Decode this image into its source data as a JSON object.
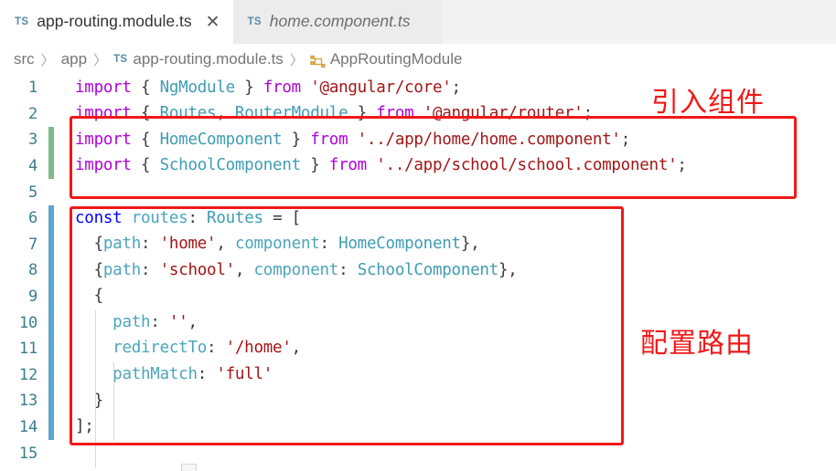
{
  "window": {
    "app": "Visual Studio Code",
    "theme": "light"
  },
  "tabs": [
    {
      "icon": "ts-file-icon",
      "label": "app-routing.module.ts",
      "active": true,
      "preview": false,
      "close_glyph": "✕"
    },
    {
      "icon": "ts-file-icon",
      "label": "home.component.ts",
      "active": false,
      "preview": true
    }
  ],
  "breadcrumb": {
    "separator": "〉",
    "items": [
      {
        "label": "src",
        "icon": null
      },
      {
        "label": "app",
        "icon": null
      },
      {
        "label": "app-routing.module.ts",
        "icon": "ts-file-icon"
      },
      {
        "label": "AppRoutingModule",
        "icon": "namespace-symbol-icon"
      }
    ]
  },
  "editor": {
    "language": "typescript",
    "line_numbers": [
      "1",
      "2",
      "3",
      "4",
      "5",
      "6",
      "7",
      "8",
      "9",
      "10",
      "11",
      "12",
      "13",
      "14",
      "15"
    ],
    "lines": [
      {
        "num": "1",
        "gutter": null,
        "text": "import { NgModule } from '@angular/core';"
      },
      {
        "num": "2",
        "gutter": null,
        "text": "import { Routes, RouterModule } from '@angular/router';"
      },
      {
        "num": "3",
        "gutter": "added",
        "text": "import { HomeComponent } from '../app/home/home.component';"
      },
      {
        "num": "4",
        "gutter": "added",
        "text": "import { SchoolComponent } from '../app/school/school.component';"
      },
      {
        "num": "5",
        "gutter": null,
        "text": ""
      },
      {
        "num": "6",
        "gutter": "modified",
        "text": "const routes: Routes = ["
      },
      {
        "num": "7",
        "gutter": "modified",
        "text": "  {path: 'home', component: HomeComponent},"
      },
      {
        "num": "8",
        "gutter": "modified",
        "text": "  {path: 'school', component: SchoolComponent},"
      },
      {
        "num": "9",
        "gutter": "modified",
        "text": "  {"
      },
      {
        "num": "10",
        "gutter": "modified",
        "text": "    path: '',"
      },
      {
        "num": "11",
        "gutter": "modified",
        "text": "    redirectTo: '/home',"
      },
      {
        "num": "12",
        "gutter": "modified",
        "text": "    pathMatch: 'full'"
      },
      {
        "num": "13",
        "gutter": "modified",
        "text": "  }"
      },
      {
        "num": "14",
        "gutter": "modified",
        "text": "];"
      },
      {
        "num": "15",
        "gutter": null,
        "text": ""
      }
    ]
  },
  "annotations": [
    {
      "name": "import-components",
      "text": "引入组件",
      "color": "#f01818",
      "box_covers_lines": "3-4"
    },
    {
      "name": "configure-routes",
      "text": "配置路由",
      "color": "#f01818",
      "box_covers_lines": "6-14"
    }
  ],
  "colors": {
    "annotation_red": "#f01818",
    "keyword_purple": "#af00db",
    "keyword_blue": "#0000ff",
    "type_teal": "#3f9cb3",
    "string_red": "#a31515",
    "linenumber_teal": "#3b7d8c",
    "gutter_added_green": "#81b88b",
    "gutter_modified_blue": "#5aa6cf",
    "tab_active_bg": "#ffffff",
    "tab_inactive_bg": "#ececec",
    "tabbar_bg": "#f3f3f3"
  }
}
